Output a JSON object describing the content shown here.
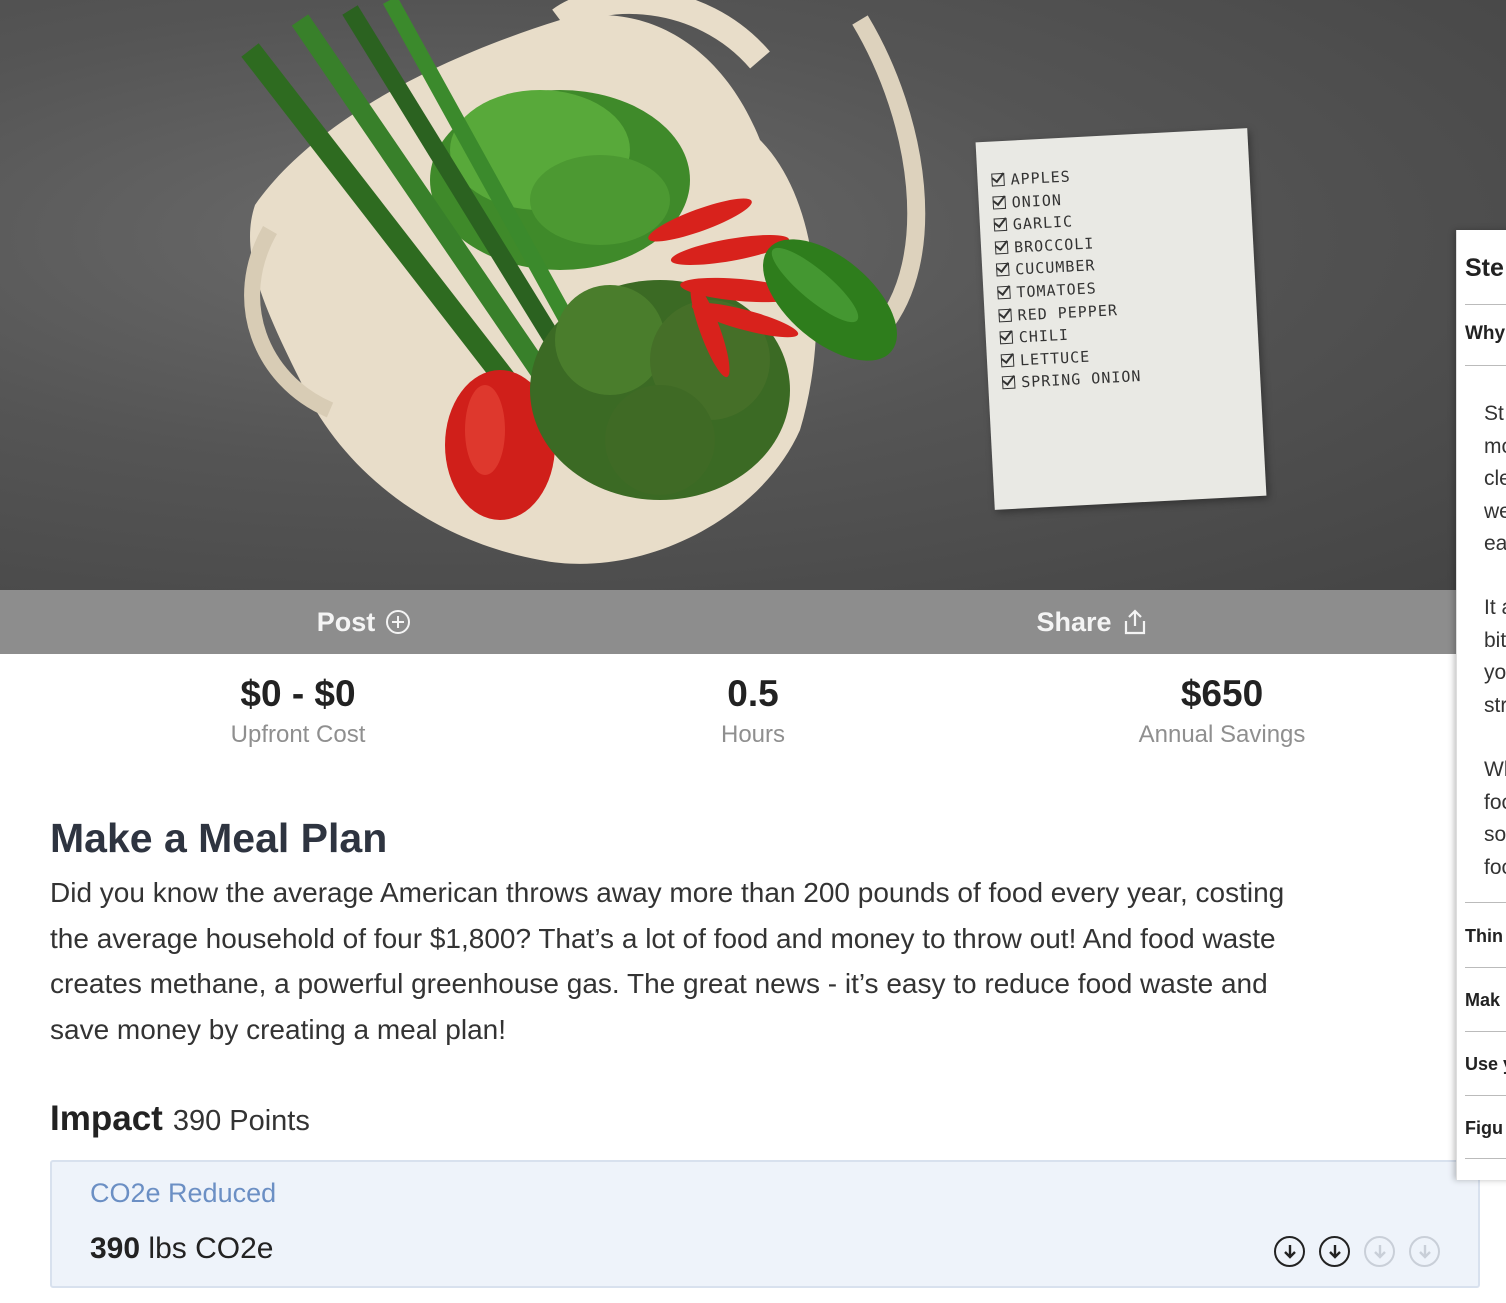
{
  "hero": {
    "shopping_list": [
      "APPLES",
      "ONION",
      "GARLIC",
      "BROCCOLI",
      "CUCUMBER",
      "TOMATOES",
      "RED PEPPER",
      "CHILI",
      "LETTUCE",
      "SPRING ONION"
    ]
  },
  "actions": {
    "post_label": "Post",
    "share_label": "Share"
  },
  "stats": [
    {
      "value": "$0 - $0",
      "label": "Upfront Cost"
    },
    {
      "value": "0.5",
      "label": "Hours"
    },
    {
      "value": "$650",
      "label": "Annual Savings"
    }
  ],
  "main": {
    "title": "Make a Meal Plan",
    "description_lines": [
      "Did you know the average American throws away more than 200 pounds of food every year, costing",
      "the average household of four $1,800?  That’s a lot of food and money to throw out!  And food waste",
      "creates methane, a powerful greenhouse gas. The great news - it’s easy to reduce food waste and",
      "save money by creating a meal plan!"
    ]
  },
  "impact": {
    "heading": "Impact",
    "points": "390 Points",
    "co2_label": "CO2e Reduced",
    "co2_value": "390",
    "co2_unit": "lbs CO2e",
    "rating_filled": 2,
    "rating_total": 4
  },
  "panel": {
    "title": "Ste",
    "question": "Why",
    "para1": [
      "St",
      "mc",
      "cle",
      "we",
      "ea"
    ],
    "para2": [
      "It a",
      "bit",
      "yo",
      "str"
    ],
    "para3": [
      "Wl",
      "foc",
      "so",
      "foc"
    ],
    "items": [
      "Thin",
      "Mak",
      "Use y",
      "Figu"
    ]
  },
  "colors": {
    "action_bar": "#8d8d8d",
    "co2_label": "#6b8fc4",
    "co2_box_bg": "#eef3fa"
  }
}
